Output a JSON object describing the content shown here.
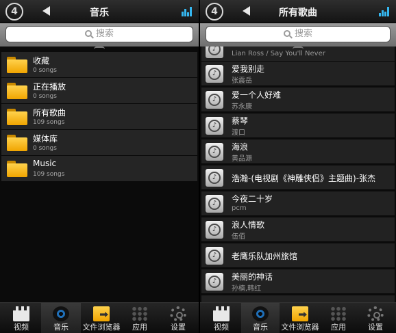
{
  "left": {
    "header": {
      "title": "音乐"
    },
    "search": {
      "placeholder": "搜索"
    },
    "items": [
      {
        "name": "收藏",
        "count": "0 songs"
      },
      {
        "name": "正在播放",
        "count": "0 songs"
      },
      {
        "name": "所有歌曲",
        "count": "109 songs"
      },
      {
        "name": "媒体库",
        "count": "0 songs"
      },
      {
        "name": "Music",
        "count": "109 songs"
      }
    ]
  },
  "right": {
    "header": {
      "title": "所有歌曲"
    },
    "search": {
      "placeholder": "搜索"
    },
    "songs": [
      {
        "title": "",
        "artist": "Lian Ross / Say You'll Never"
      },
      {
        "title": "爱我别走",
        "artist": "张震岳"
      },
      {
        "title": "爱一个人好难",
        "artist": "苏永康"
      },
      {
        "title": "蔡琴",
        "artist": "渡口"
      },
      {
        "title": "海浪",
        "artist": "黄品源"
      },
      {
        "title": "浩瀚-(电视剧《神雕侠侣》主题曲)-张杰",
        "artist": ""
      },
      {
        "title": "今夜二十岁",
        "artist": "pcm"
      },
      {
        "title": "浪人情歌",
        "artist": "伍佰"
      },
      {
        "title": "老鹰乐队加州旅馆",
        "artist": ""
      },
      {
        "title": "美丽的神话",
        "artist": "孙楠,韩红"
      }
    ]
  },
  "tabs": [
    {
      "label": "视频",
      "icon": "video-icon"
    },
    {
      "label": "音乐",
      "icon": "music-disc-icon"
    },
    {
      "label": "文件浏览器",
      "icon": "file-browser-icon"
    },
    {
      "label": "应用",
      "icon": "apps-grid-icon"
    },
    {
      "label": "设置",
      "icon": "settings-gear-icon"
    }
  ],
  "colors": {
    "accent": "#35b7f0",
    "folder": "#f0a400"
  }
}
